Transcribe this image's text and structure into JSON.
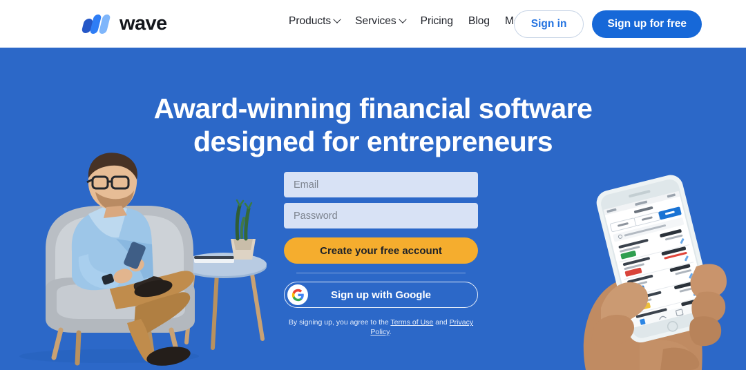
{
  "header": {
    "logo": {
      "text": "wave",
      "icon": "wave-logo-icon"
    },
    "nav": [
      {
        "label": "Products",
        "has_caret": true
      },
      {
        "label": "Services",
        "has_caret": true
      },
      {
        "label": "Pricing",
        "has_caret": false
      },
      {
        "label": "Blog",
        "has_caret": false
      },
      {
        "label": "More",
        "has_caret": true
      }
    ],
    "sign_in_label": "Sign in",
    "sign_up_label": "Sign up for free"
  },
  "hero": {
    "headline_line1": "Award-winning financial software",
    "headline_line2": "designed for entrepreneurs",
    "background_color": "#2c68c8",
    "form": {
      "email_placeholder": "Email",
      "email_value": "",
      "password_placeholder": "Password",
      "password_value": "",
      "create_account_label": "Create your free account",
      "google_label": "Sign up with Google",
      "google_icon": "google-g-icon",
      "legal_prefix": "By signing up, you agree to the ",
      "legal_terms": "Terms of Use",
      "legal_middle": " and ",
      "legal_privacy": "Privacy Policy",
      "legal_suffix": "."
    },
    "left_image_alt": "man-in-armchair-using-phone",
    "right_image_alt": "hands-holding-phone-invoice-app"
  },
  "colors": {
    "hero_blue": "#2c68c8",
    "brand_blue": "#1668d8",
    "cta_orange": "#f5ad2e",
    "input_fill": "#d8e2f5"
  }
}
